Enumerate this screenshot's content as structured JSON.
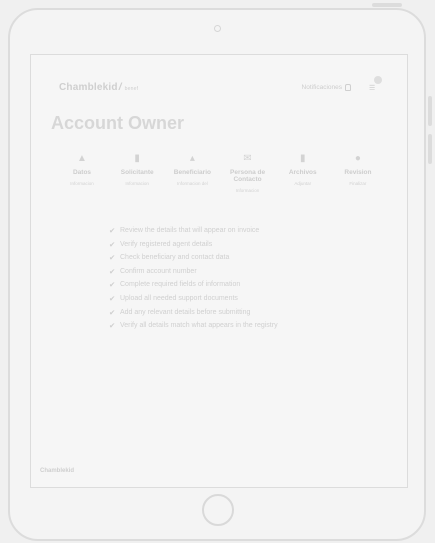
{
  "header": {
    "logo_text": "Chamblekid",
    "logo_sub": "benef",
    "notifications_label": "Notificaciones",
    "bell_icon": "bell-icon",
    "menu_icon": "menu-icon"
  },
  "page": {
    "title": "Account Owner"
  },
  "steps": [
    {
      "icon": "clipboard-icon",
      "glyph": "▲",
      "label": "Datos",
      "sub": "Informacion"
    },
    {
      "icon": "document-icon",
      "glyph": "▮",
      "label": "Solicitante",
      "sub": "Informacion"
    },
    {
      "icon": "person-icon",
      "glyph": "▴",
      "label": "Beneficiario",
      "sub": "Informacion del"
    },
    {
      "icon": "envelope-icon",
      "glyph": "✉",
      "label": "Persona de Contacto",
      "sub": "Informacion"
    },
    {
      "icon": "file-icon",
      "glyph": "▮",
      "label": "Archivos",
      "sub": "Adjuntar"
    },
    {
      "icon": "info-icon",
      "glyph": "●",
      "label": "Revision",
      "sub": "Finalizar"
    }
  ],
  "checklist": [
    "Review the details that will appear on invoice",
    "Verify registered agent details",
    "Check beneficiary and contact data",
    "Confirm account number",
    "Complete required fields of information",
    "Upload all needed support documents",
    "Add any relevant details before submitting",
    "Verify all details match what appears in the registry"
  ],
  "footer": {
    "logo_text": "Chamblekid"
  }
}
